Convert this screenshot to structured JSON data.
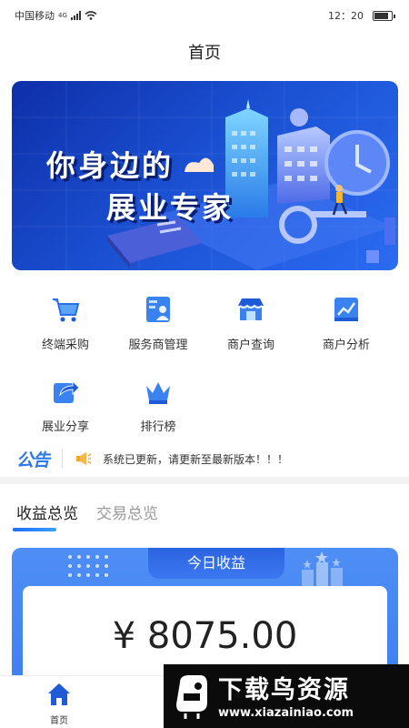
{
  "status_bar": {
    "carrier": "中国移动",
    "network": "4G",
    "time": "12：20"
  },
  "header": {
    "title": "首页"
  },
  "banner": {
    "line1": "你身边的",
    "line2": "展业专家"
  },
  "menu": {
    "items": [
      {
        "label": "终端采购",
        "icon": "cart-icon"
      },
      {
        "label": "服务商管理",
        "icon": "contact-card-icon"
      },
      {
        "label": "商户查询",
        "icon": "storefront-icon"
      },
      {
        "label": "商户分析",
        "icon": "chart-icon"
      },
      {
        "label": "展业分享",
        "icon": "share-icon"
      },
      {
        "label": "排行榜",
        "icon": "crown-icon"
      }
    ]
  },
  "notice": {
    "logo": "公告",
    "text": "系统已更新，请更新至最新版本！！！"
  },
  "tabs": [
    {
      "label": "收益总览",
      "active": true
    },
    {
      "label": "交易总览",
      "active": false
    }
  ],
  "earnings": {
    "title": "今日收益",
    "amount": "¥ 8075.00"
  },
  "bottom_nav": {
    "home_label": "首页"
  },
  "watermark": {
    "title": "下载鸟资源",
    "url": "www.xiazainiao.com"
  },
  "colors": {
    "primary": "#2f78e8",
    "banner_dark": "#0e2fa8",
    "card": "#4e8ef5"
  }
}
